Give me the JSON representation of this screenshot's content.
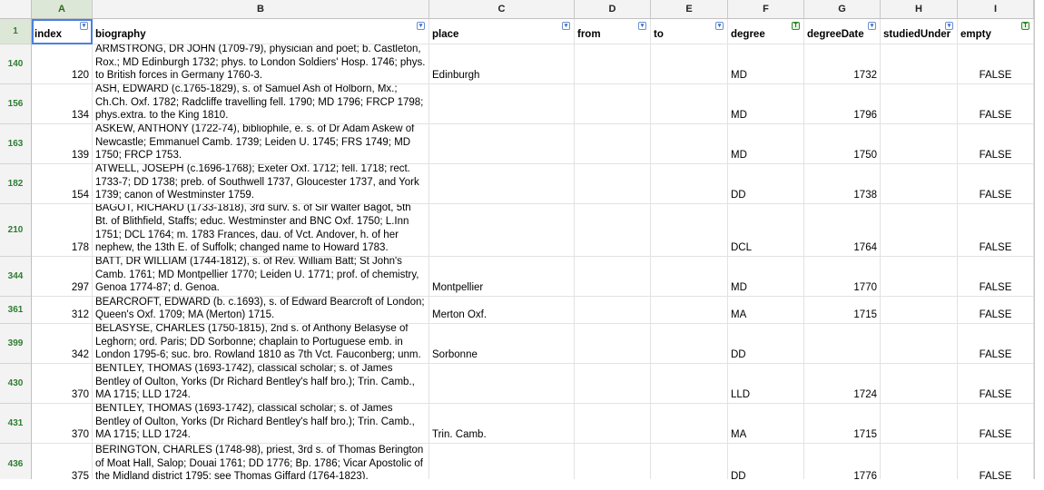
{
  "columns": [
    {
      "letter": "A",
      "header": "index",
      "filter": "menu"
    },
    {
      "letter": "B",
      "header": "biography",
      "filter": "menu"
    },
    {
      "letter": "C",
      "header": "place",
      "filter": "menu"
    },
    {
      "letter": "D",
      "header": "from",
      "filter": "menu"
    },
    {
      "letter": "E",
      "header": "to",
      "filter": "menu"
    },
    {
      "letter": "F",
      "header": "degree",
      "filter": "active"
    },
    {
      "letter": "G",
      "header": "degreeDate",
      "filter": "menu"
    },
    {
      "letter": "H",
      "header": "studiedUnder",
      "filter": "menu"
    },
    {
      "letter": "I",
      "header": "empty",
      "filter": "active"
    }
  ],
  "header_row_number": "1",
  "rows": [
    {
      "rownum": "140",
      "index": "120",
      "biography": "ARMSTRONG, DR JOHN (1709-79), physician and poet; b. Castleton, Rox.; MD Edinburgh 1732; phys. to London Soldiers' Hosp. 1746; phys. to British forces in Germany 1760-3.",
      "place": "Edinburgh",
      "from": "",
      "to": "",
      "degree": "MD",
      "degreeDate": "1732",
      "studiedUnder": "",
      "empty": "FALSE"
    },
    {
      "rownum": "156",
      "index": "134",
      "biography": "ASH, EDWARD (c.1765-1829), s. of Samuel Ash of Holborn, Mx.; Ch.Ch. Oxf. 1782; Radcliffe travelling fell. 1790; MD 1796; FRCP 1798; phys.extra. to the King 1810.",
      "place": "",
      "from": "",
      "to": "",
      "degree": "MD",
      "degreeDate": "1796",
      "studiedUnder": "",
      "empty": "FALSE"
    },
    {
      "rownum": "163",
      "index": "139",
      "biography": "ASKEW, ANTHONY (1722-74), bibliophile, e. s. of Dr Adam Askew of Newcastle; Emmanuel Camb. 1739; Leiden U. 1745; FRS 1749; MD 1750; FRCP 1753.",
      "place": "",
      "from": "",
      "to": "",
      "degree": "MD",
      "degreeDate": "1750",
      "studiedUnder": "",
      "empty": "FALSE"
    },
    {
      "rownum": "182",
      "index": "154",
      "biography": "ATWELL, JOSEPH (c.1696-1768); Exeter Oxf. 1712; fell. 1718; rect. 1733-7; DD 1738; preb. of Southwell 1737, Gloucester 1737, and York 1739; canon of Westminster 1759.",
      "place": "",
      "from": "",
      "to": "",
      "degree": "DD",
      "degreeDate": "1738",
      "studiedUnder": "",
      "empty": "FALSE"
    },
    {
      "rownum": "210",
      "index": "178",
      "biography": "BAGOT, RICHARD (1733-1818), 3rd surv. s. of Sir Walter Bagot, 5th Bt. of Blithfield, Staffs; educ. Westminster and BNC Oxf. 1750; L.Inn 1751; DCL 1764; m. 1783 Frances, dau. of Vct. Andover, h. of her nephew, the 13th E. of Suffolk; changed name to Howard 1783.",
      "place": "",
      "from": "",
      "to": "",
      "degree": "DCL",
      "degreeDate": "1764",
      "studiedUnder": "",
      "empty": "FALSE"
    },
    {
      "rownum": "344",
      "index": "297",
      "biography": "BATT, DR WILLIAM (1744-1812), s. of Rev. William Batt; St John's Camb. 1761; MD Montpellier 1770; Leiden U. 1771; prof. of chemistry, Genoa 1774-87; d. Genoa.",
      "place": "Montpellier",
      "from": "",
      "to": "",
      "degree": "MD",
      "degreeDate": "1770",
      "studiedUnder": "",
      "empty": "FALSE"
    },
    {
      "rownum": "361",
      "index": "312",
      "biography": "BEARCROFT, EDWARD (b. c.1693), s. of Edward Bearcroft of London; Queen's Oxf. 1709; MA (Merton) 1715.",
      "place": "Merton Oxf.",
      "from": "",
      "to": "",
      "degree": "MA",
      "degreeDate": "1715",
      "studiedUnder": "",
      "empty": "FALSE"
    },
    {
      "rownum": "399",
      "index": "342",
      "biography": "BELASYSE, CHARLES (1750-1815), 2nd s. of Anthony Belasyse of Leghorn; ord. Paris; DD Sorbonne; chaplain to Portuguese emb. in London 1795-6; suc. bro. Rowland 1810 as 7th Vct. Fauconberg; unm.",
      "place": "Sorbonne",
      "from": "",
      "to": "",
      "degree": "DD",
      "degreeDate": "",
      "studiedUnder": "",
      "empty": "FALSE"
    },
    {
      "rownum": "430",
      "index": "370",
      "biography": "BENTLEY, THOMAS (1693-1742), classical scholar; s. of James Bentley of Oulton, Yorks (Dr Richard Bentley's half bro.); Trin. Camb., MA 1715; LLD 1724.",
      "place": "",
      "from": "",
      "to": "",
      "degree": "LLD",
      "degreeDate": "1724",
      "studiedUnder": "",
      "empty": "FALSE"
    },
    {
      "rownum": "431",
      "index": "370",
      "biography": "BENTLEY, THOMAS (1693-1742), classical scholar; s. of James Bentley of Oulton, Yorks (Dr Richard Bentley's half bro.); Trin. Camb., MA 1715; LLD 1724.",
      "place": "Trin. Camb.",
      "from": "",
      "to": "",
      "degree": "MA",
      "degreeDate": "1715",
      "studiedUnder": "",
      "empty": "FALSE"
    },
    {
      "rownum": "436",
      "index": "375",
      "biography": "BERINGTON, CHARLES (1748-98), priest, 3rd s. of Thomas Berington of Moat Hall, Salop; Douai 1761; DD 1776; Bp. 1786; Vicar Apostolic of the Midland district 1795; see Thomas Giffard (1764-1823).",
      "place": "",
      "from": "",
      "to": "",
      "degree": "DD",
      "degreeDate": "1776",
      "studiedUnder": "",
      "empty": "FALSE"
    }
  ]
}
